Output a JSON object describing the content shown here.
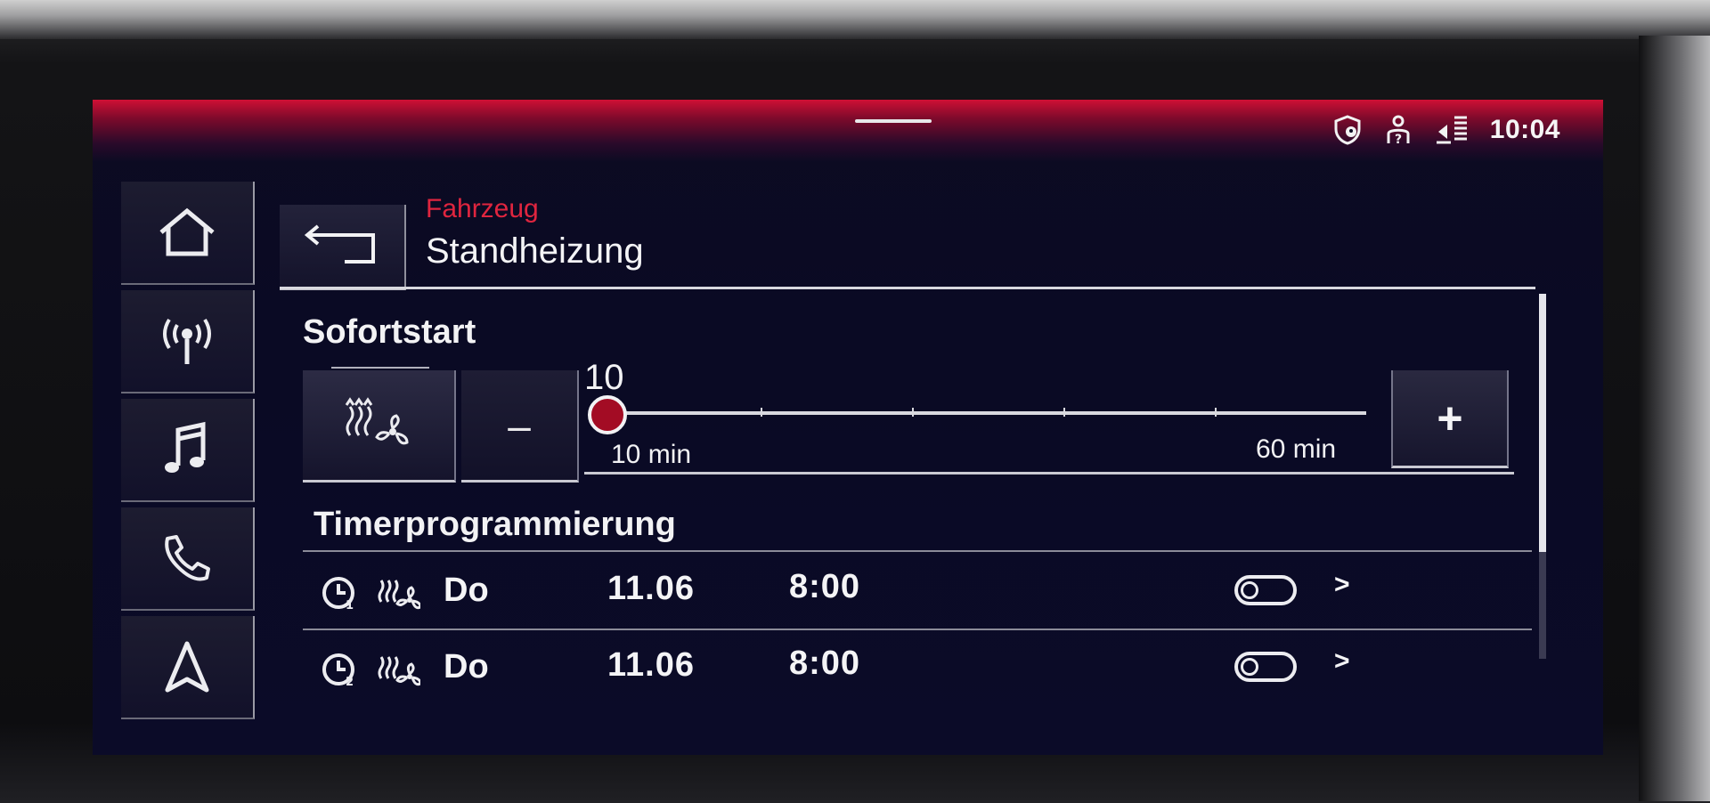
{
  "status_bar": {
    "icons": [
      "shield-location-icon",
      "person-question-icon",
      "traffic-sign-icon"
    ],
    "time": "10:04"
  },
  "sidebar": {
    "items": [
      {
        "name": "home",
        "icon": "home-icon"
      },
      {
        "name": "radio",
        "icon": "radio-antenna-icon"
      },
      {
        "name": "media",
        "icon": "music-note-icon"
      },
      {
        "name": "phone",
        "icon": "phone-icon"
      },
      {
        "name": "navigation",
        "icon": "navigation-arrow-icon"
      }
    ]
  },
  "header": {
    "breadcrumb": "Fahrzeug",
    "title": "Standheizung"
  },
  "sofortstart": {
    "label": "Sofortstart",
    "minus_label": "–",
    "plus_label": "+",
    "slider": {
      "value": "10",
      "min_label": "10 min",
      "max_label": "60 min",
      "min": 10,
      "max": 60,
      "current": 10
    }
  },
  "timer": {
    "label": "Timerprogrammierung",
    "rows": [
      {
        "day": "Do",
        "date": "11.06",
        "time": "8:00",
        "enabled": false,
        "chevron": ">"
      },
      {
        "day": "Do",
        "date": "11.06",
        "time": "8:00",
        "enabled": false,
        "chevron": ">"
      }
    ]
  },
  "colors": {
    "accent_red": "#e0253f",
    "background": "#0c0b22",
    "text": "#f4f4f6"
  }
}
